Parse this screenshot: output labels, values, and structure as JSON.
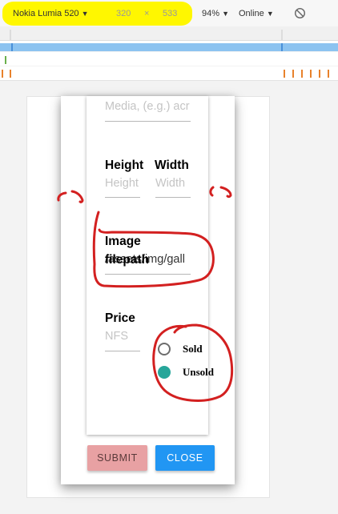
{
  "devtools": {
    "device": "Nokia Lumia 520",
    "width": "320",
    "times": "×",
    "height": "533",
    "zoom": "94%",
    "network": "Online",
    "dropdown_arrow": "▼",
    "rotate_icon": "rotate-icon"
  },
  "form": {
    "medium_placeholder": "Media, (e.g.) acr",
    "height_label": "Height",
    "height_placeholder": "Height",
    "width_label": "Width",
    "width_placeholder": "Width",
    "image_label_line1": "Image",
    "image_label_line2": "filepath",
    "image_value": "/assets/img/gall",
    "price_label": "Price",
    "price_placeholder": "NFS",
    "sold_label": "Sold",
    "unsold_label": "Unsold",
    "unsold_selected": true
  },
  "buttons": {
    "submit": "SUBMIT",
    "close": "CLOSE"
  },
  "colors": {
    "highlight": "#fff700",
    "annotation": "#d32020",
    "submit_bg": "#e8a1a3",
    "close_bg": "#2196f3",
    "radio_on": "#26a69a"
  }
}
